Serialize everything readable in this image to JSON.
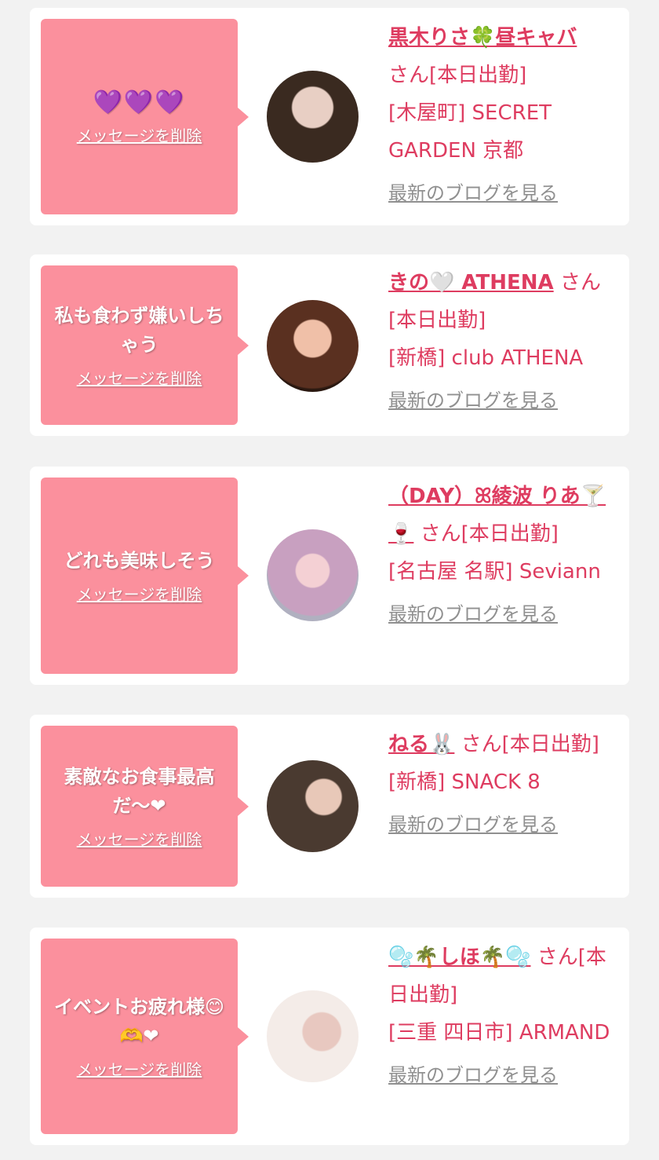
{
  "cards": [
    {
      "message": "💜💜💜",
      "delete_label": "メッセージを削除",
      "name": "黒木りさ🍀昼キャバ",
      "suffix": "さん[本日出勤]",
      "area_store": "[木屋町] SECRET GARDEN 京都",
      "blog_label": "最新のブログを見る",
      "avatar_colors": [
        "#3a2a20",
        "#d8b8a8"
      ]
    },
    {
      "message": "私も食わず嫌いしちゃう",
      "delete_label": "メッセージを削除",
      "name": "きの🤍 ATHENA",
      "suffix": "さん[本日出勤]",
      "area_store": "[新橋] club ATHENA",
      "blog_label": "最新のブログを見る",
      "avatar_colors": [
        "#5a3020",
        "#e0a890"
      ]
    },
    {
      "message": "どれも美味しそう",
      "delete_label": "メッセージを削除",
      "name": "（DAY）ꕤ綾波 りあ🍸🍷",
      "suffix": "さん[本日出勤]",
      "area_store": "[名古屋 名駅] Seviann",
      "blog_label": "最新のブログを見る",
      "avatar_colors": [
        "#b8a8c8",
        "#f0c8d0"
      ]
    },
    {
      "message": "素敵なお食事最高だ〜❤",
      "delete_label": "メッセージを削除",
      "name": "ねる🐰",
      "suffix": "さん[本日出勤]",
      "area_store": "[新橋] SNACK 8",
      "blog_label": "最新のブログを見る",
      "avatar_colors": [
        "#4a3a30",
        "#c89060"
      ]
    },
    {
      "message": "イベントお疲れ様😊🫶❤",
      "delete_label": "メッセージを削除",
      "name": "🫧🌴しほ🌴🫧",
      "suffix": "さん[本日出勤]",
      "area_store": "[三重 四日市] ARMAND",
      "blog_label": "最新のブログを見る",
      "avatar_colors": [
        "#f4e8e4",
        "#d8a8a0"
      ]
    }
  ],
  "colors": {
    "accent": "#de3c60",
    "bubble": "#fb909d",
    "background": "#f2f2f2",
    "blog_link": "#909090"
  }
}
